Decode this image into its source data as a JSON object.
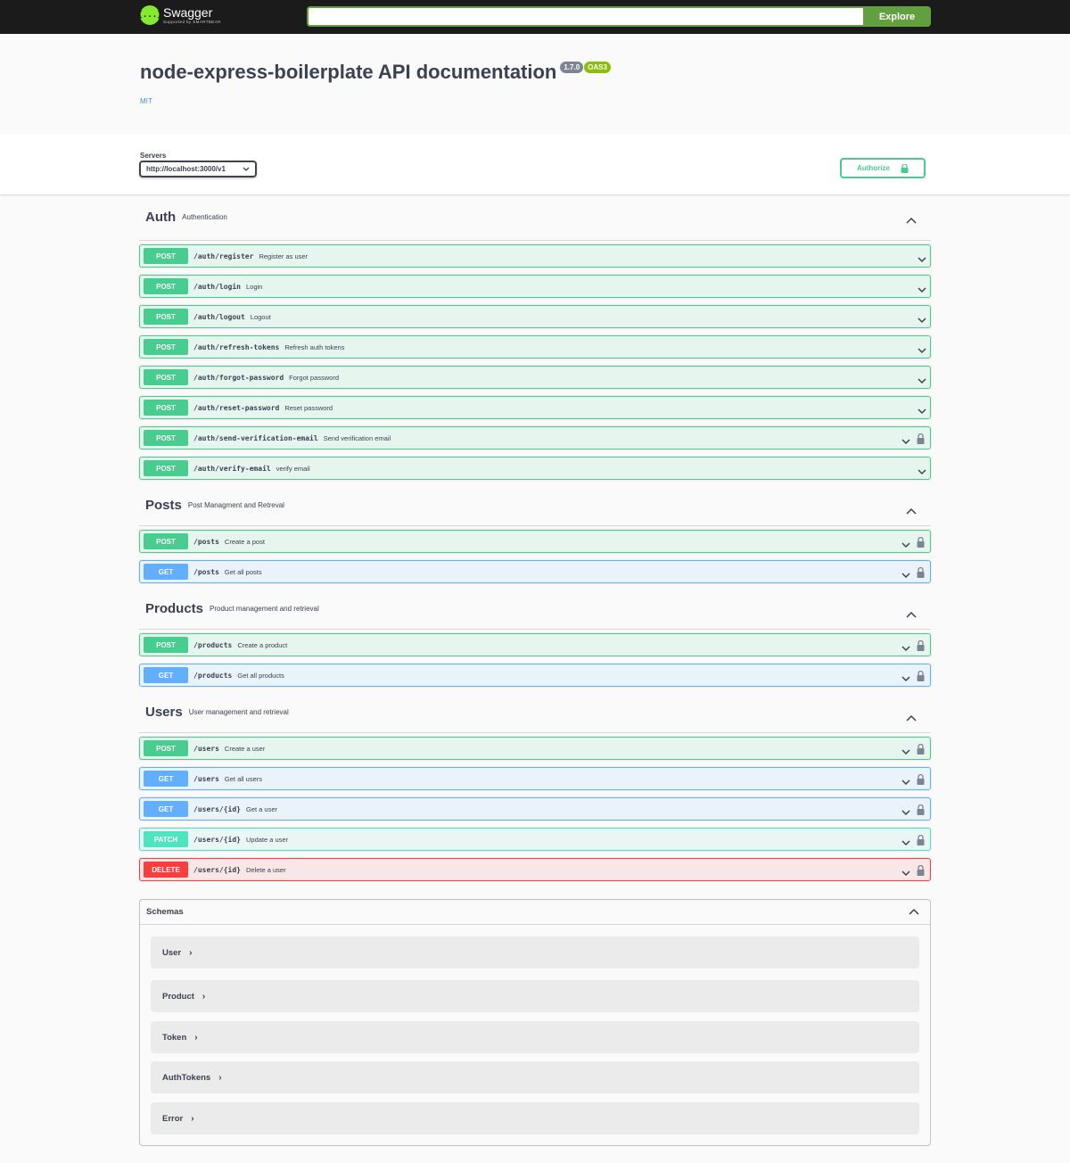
{
  "topbar": {
    "logo_name": "Swagger",
    "logo_sub": "Supported by SMARTBEAR",
    "logo_glyph": "{...}",
    "search_value": "",
    "explore_label": "Explore"
  },
  "info": {
    "title": "node-express-boilerplate API documentation",
    "version": "1.7.0",
    "oas": "OAS3",
    "license": "MIT"
  },
  "servers": {
    "label": "Servers",
    "selected": "http://localhost:3000/v1"
  },
  "authorize": {
    "label": "Authorize"
  },
  "tags": [
    {
      "name": "Auth",
      "description": "Authentication",
      "operations": [
        {
          "method": "POST",
          "path": "/auth/register",
          "summary": "Register as user",
          "locked": false
        },
        {
          "method": "POST",
          "path": "/auth/login",
          "summary": "Login",
          "locked": false
        },
        {
          "method": "POST",
          "path": "/auth/logout",
          "summary": "Logout",
          "locked": false
        },
        {
          "method": "POST",
          "path": "/auth/refresh-tokens",
          "summary": "Refresh auth tokens",
          "locked": false
        },
        {
          "method": "POST",
          "path": "/auth/forgot-password",
          "summary": "Forgot password",
          "locked": false
        },
        {
          "method": "POST",
          "path": "/auth/reset-password",
          "summary": "Reset password",
          "locked": false
        },
        {
          "method": "POST",
          "path": "/auth/send-verification-email",
          "summary": "Send verification email",
          "locked": true
        },
        {
          "method": "POST",
          "path": "/auth/verify-email",
          "summary": "verify email",
          "locked": false
        }
      ]
    },
    {
      "name": "Posts",
      "description": "Post Managment and Retreval",
      "operations": [
        {
          "method": "POST",
          "path": "/posts",
          "summary": "Create a post",
          "locked": true
        },
        {
          "method": "GET",
          "path": "/posts",
          "summary": "Get all posts",
          "locked": true
        }
      ]
    },
    {
      "name": "Products",
      "description": "Product management and retrieval",
      "operations": [
        {
          "method": "POST",
          "path": "/products",
          "summary": "Create a product",
          "locked": true
        },
        {
          "method": "GET",
          "path": "/products",
          "summary": "Get all products",
          "locked": true
        }
      ]
    },
    {
      "name": "Users",
      "description": "User management and retrieval",
      "operations": [
        {
          "method": "POST",
          "path": "/users",
          "summary": "Create a user",
          "locked": true
        },
        {
          "method": "GET",
          "path": "/users",
          "summary": "Get all users",
          "locked": true
        },
        {
          "method": "GET",
          "path": "/users/{id}",
          "summary": "Get a user",
          "locked": true
        },
        {
          "method": "PATCH",
          "path": "/users/{id}",
          "summary": "Update a user",
          "locked": true
        },
        {
          "method": "DELETE",
          "path": "/users/{id}",
          "summary": "Delete a user",
          "locked": true
        }
      ]
    }
  ],
  "schemas": {
    "title": "Schemas",
    "models": [
      "User",
      "Product",
      "Token",
      "AuthTokens",
      "Error"
    ]
  },
  "colors": {
    "post": "#49cc90",
    "get": "#61affe",
    "patch": "#50e3c2",
    "delete": "#f93e3e",
    "topbar": "#1b1b1b",
    "explore": "#62a03f"
  }
}
